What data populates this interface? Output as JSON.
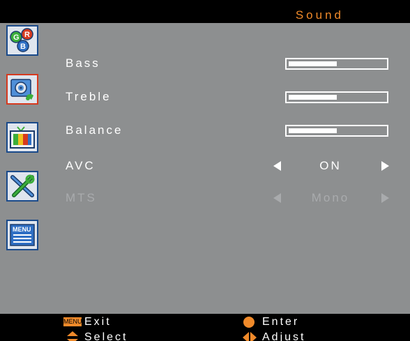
{
  "header": {
    "title": "Sound"
  },
  "sidebar": {
    "items": [
      {
        "icon": "color-picture-icon",
        "active": false
      },
      {
        "icon": "sound-speaker-icon",
        "active": true
      },
      {
        "icon": "tv-channel-icon",
        "active": false
      },
      {
        "icon": "setup-tools-icon",
        "active": false
      },
      {
        "icon": "menu-icon",
        "active": false
      }
    ]
  },
  "menu": {
    "rows": [
      {
        "label": "Bass",
        "type": "slider",
        "level": 0.5
      },
      {
        "label": "Treble",
        "type": "slider",
        "level": 0.5
      },
      {
        "label": "Balance",
        "type": "slider",
        "level": 0.5
      },
      {
        "label": "AVC",
        "type": "selector",
        "value": "ON",
        "enabled": true
      },
      {
        "label": "MTS",
        "type": "selector",
        "value": "Mono",
        "enabled": false
      }
    ]
  },
  "footer": {
    "exit_key": "MENU",
    "exit_label": "Exit",
    "enter_label": "Enter",
    "select_label": "Select",
    "adjust_label": "Adjust"
  },
  "colors": {
    "accent": "#f08a2a",
    "panel": "#8d8f90",
    "background": "#000000",
    "text": "#ffffff",
    "disabled_text": "#a9abad"
  }
}
